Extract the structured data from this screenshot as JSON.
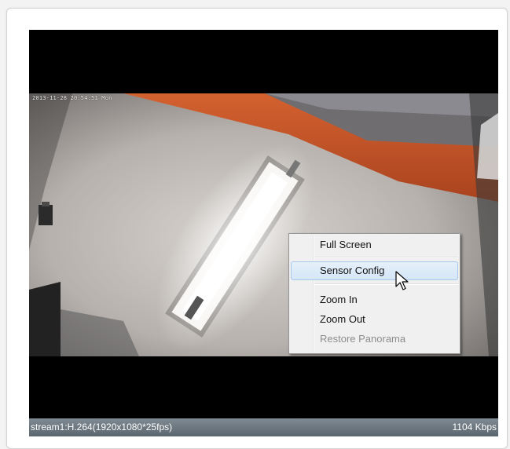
{
  "video": {
    "osd_timestamp": "2013-11-28 20:54:51 Mon"
  },
  "context_menu": {
    "items": [
      {
        "label": "Full Screen",
        "state": "normal"
      },
      {
        "label": "Sensor Config",
        "state": "hover"
      },
      {
        "label": "Zoom In",
        "state": "normal"
      },
      {
        "label": "Zoom Out",
        "state": "normal"
      },
      {
        "label": "Restore Panorama",
        "state": "disabled"
      }
    ]
  },
  "status_bar": {
    "stream_info": "stream1:H.264(1920x1080*25fps)",
    "bitrate": "1104 Kbps"
  },
  "icons": {
    "cursor": "pointer-cursor-icon"
  },
  "colors": {
    "status_bar": "#6b767e",
    "menu_highlight": "#dbe9f8",
    "wall_orange": "#c8552a"
  }
}
